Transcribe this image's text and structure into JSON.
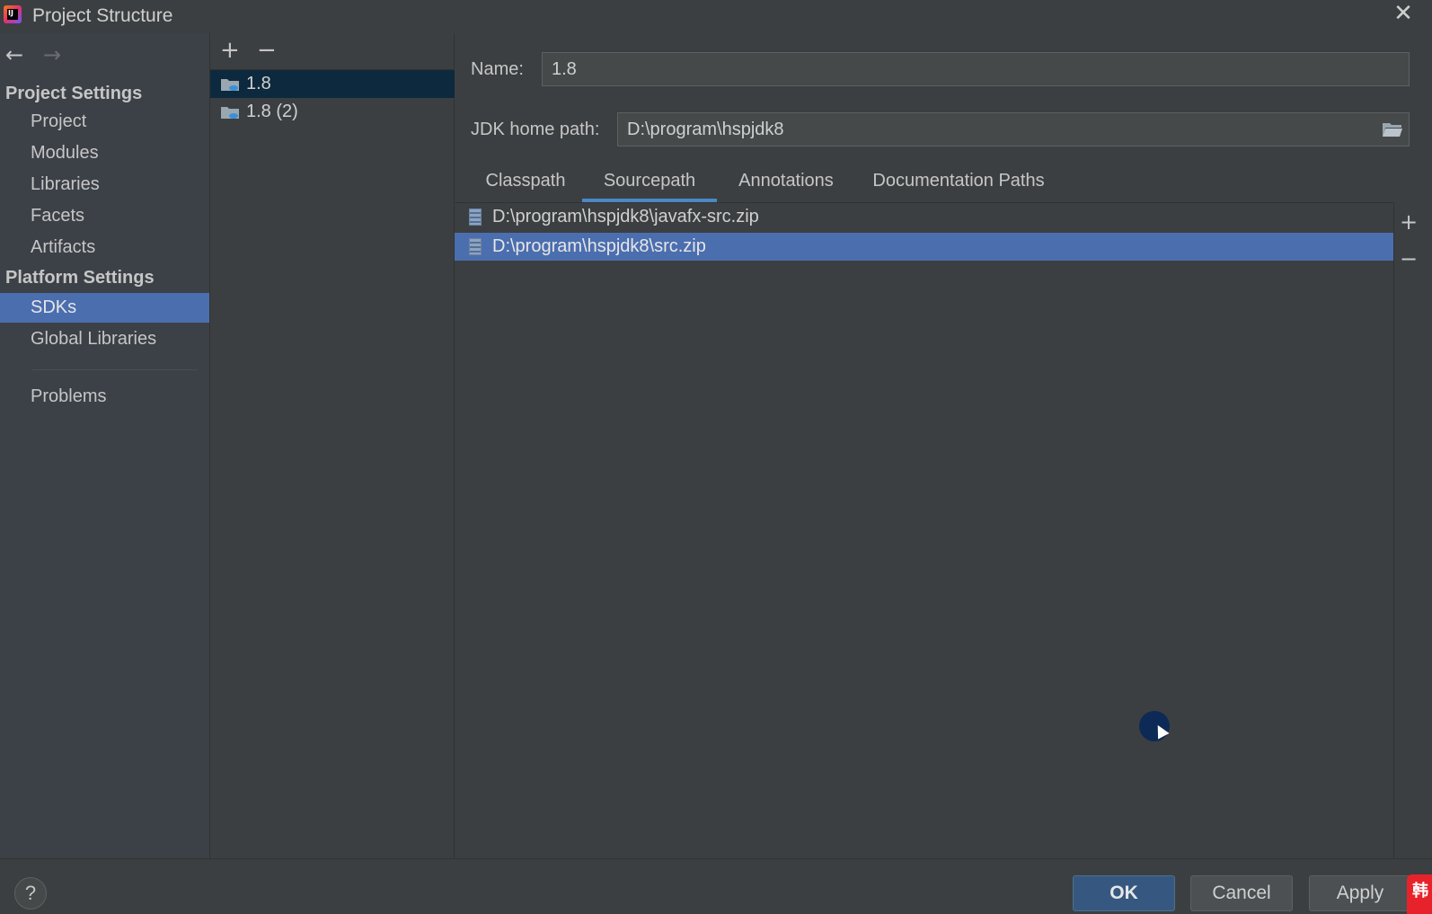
{
  "window": {
    "title": "Project Structure",
    "app_icon_text": "IJ",
    "close_glyph": "✕"
  },
  "sidebar": {
    "back_glyph": "←",
    "forward_glyph": "→",
    "project_settings_header": "Project Settings",
    "project_items": [
      {
        "label": "Project"
      },
      {
        "label": "Modules"
      },
      {
        "label": "Libraries"
      },
      {
        "label": "Facets"
      },
      {
        "label": "Artifacts"
      }
    ],
    "platform_settings_header": "Platform Settings",
    "platform_items": [
      {
        "label": "SDKs",
        "selected": true
      },
      {
        "label": "Global Libraries"
      }
    ],
    "problems_label": "Problems"
  },
  "sdk_list": {
    "add_glyph": "+",
    "remove_glyph": "−",
    "items": [
      {
        "label": "1.8",
        "selected": true
      },
      {
        "label": "1.8 (2)"
      }
    ]
  },
  "detail": {
    "name_label": "Name:",
    "name_value": "1.8",
    "jdk_home_label": "JDK home path:",
    "jdk_home_value": "D:\\program\\hspjdk8",
    "tabs": [
      {
        "label": "Classpath"
      },
      {
        "label": "Sourcepath",
        "active": true
      },
      {
        "label": "Annotations"
      },
      {
        "label": "Documentation Paths"
      }
    ],
    "paths": [
      {
        "label": "D:\\program\\hspjdk8\\javafx-src.zip"
      },
      {
        "label": "D:\\program\\hspjdk8\\src.zip",
        "selected": true
      }
    ],
    "add_glyph": "+",
    "remove_glyph": "−"
  },
  "footer": {
    "help_glyph": "?",
    "ok_label": "OK",
    "cancel_label": "Cancel",
    "apply_label": "Apply"
  },
  "badge_text": "韩",
  "colors": {
    "selection": "#4b6eaf",
    "sdk_selection": "#0d293e",
    "tab_underline": "#4a88c7",
    "ok_button": "#365880"
  },
  "icons": {
    "folder": "folder-icon",
    "jar": "jar-file-icon",
    "browse": "open-folder-icon"
  }
}
